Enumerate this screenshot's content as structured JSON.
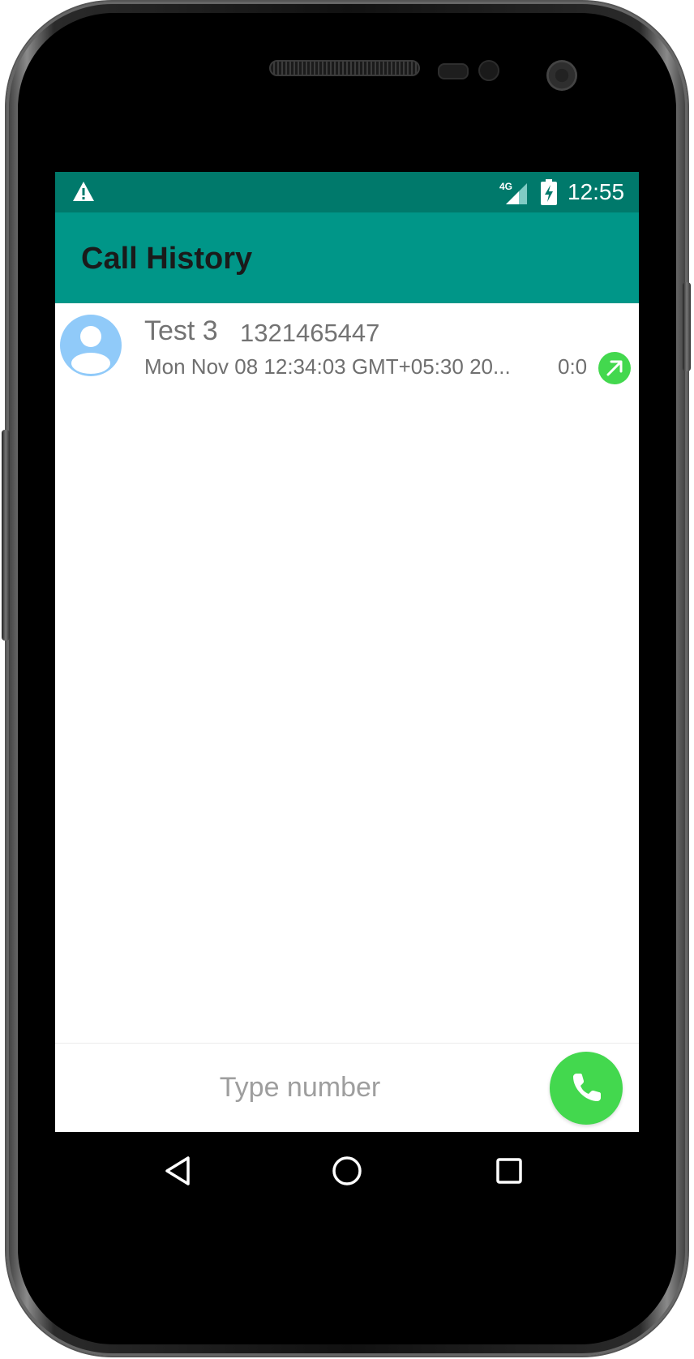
{
  "status_bar": {
    "time": "12:55",
    "network_label": "4G",
    "icons": [
      "warning-icon",
      "signal-4g-icon",
      "battery-charging-icon"
    ]
  },
  "app_bar": {
    "title": "Call History"
  },
  "call_history": [
    {
      "name": "Test 3",
      "number": "1321465447",
      "datetime": "Mon Nov 08 12:34:03 GMT+05:30 20...",
      "duration": "0:0",
      "call_type_icon": "outgoing-call-icon",
      "avatar_icon": "person-icon"
    }
  ],
  "dialer": {
    "input_value": "",
    "placeholder": "Type number",
    "call_icon": "phone-icon"
  },
  "nav_bar": {
    "icons": [
      "back-icon",
      "home-icon",
      "recents-icon"
    ]
  },
  "colors": {
    "status_bar": "#00796b",
    "app_bar": "#009688",
    "accent_green": "#43d84e",
    "avatar_bg": "#90caf9"
  }
}
